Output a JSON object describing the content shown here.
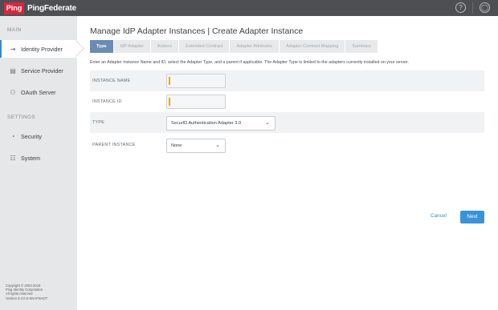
{
  "brand": {
    "mark": "Ping",
    "name": "PingFederate"
  },
  "topbar": {
    "help_icon": "help-icon",
    "user_icon": "user-icon",
    "help_glyph": "?",
    "user_glyph": "◯"
  },
  "sidebar": {
    "main_label": "MAIN",
    "settings_label": "SETTINGS",
    "items": [
      {
        "label": "Identity Provider",
        "icon": "identity-provider-icon",
        "glyph": "⇥"
      },
      {
        "label": "Service Provider",
        "icon": "service-provider-icon",
        "glyph": "▤"
      },
      {
        "label": "OAuth Server",
        "icon": "oauth-server-icon",
        "glyph": "⚇"
      },
      {
        "label": "Security",
        "icon": "security-icon",
        "glyph": "◔"
      },
      {
        "label": "System",
        "icon": "system-icon",
        "glyph": "☷"
      }
    ],
    "footer": [
      "Copyright © 2003-2019",
      "Ping Identity Corporation",
      "All rights reserved",
      "Version 9.3.0.5-SNAPSHOT"
    ]
  },
  "main": {
    "title": "Manage IdP Adapter Instances | Create Adapter Instance",
    "tabs": [
      "Type",
      "IdP Adapter",
      "Actions",
      "Extended Contract",
      "Adapter Attributes",
      "Adapter Contract Mapping",
      "Summary"
    ],
    "intro": "Enter an Adapter Instance Name and ID, select the Adapter Type, and a parent if applicable. The Adapter Type is limited to the adapters currently installed on your server.",
    "fields": {
      "instance_name": {
        "label": "INSTANCE NAME",
        "value": ""
      },
      "instance_id": {
        "label": "INSTANCE ID",
        "value": ""
      },
      "type": {
        "label": "TYPE",
        "value": "SecurID Authentication Adapter 3.0"
      },
      "parent": {
        "label": "PARENT INSTANCE",
        "value": "None"
      }
    },
    "cancel_label": "Cancel",
    "next_label": "Next",
    "chevron": "⌄"
  },
  "colors": {
    "accent": "#2e8bd5",
    "topbar": "#4d4f53",
    "brand_red": "#d7263d",
    "active_tab": "#6a8cb3",
    "input_marker": "#e5a823"
  }
}
